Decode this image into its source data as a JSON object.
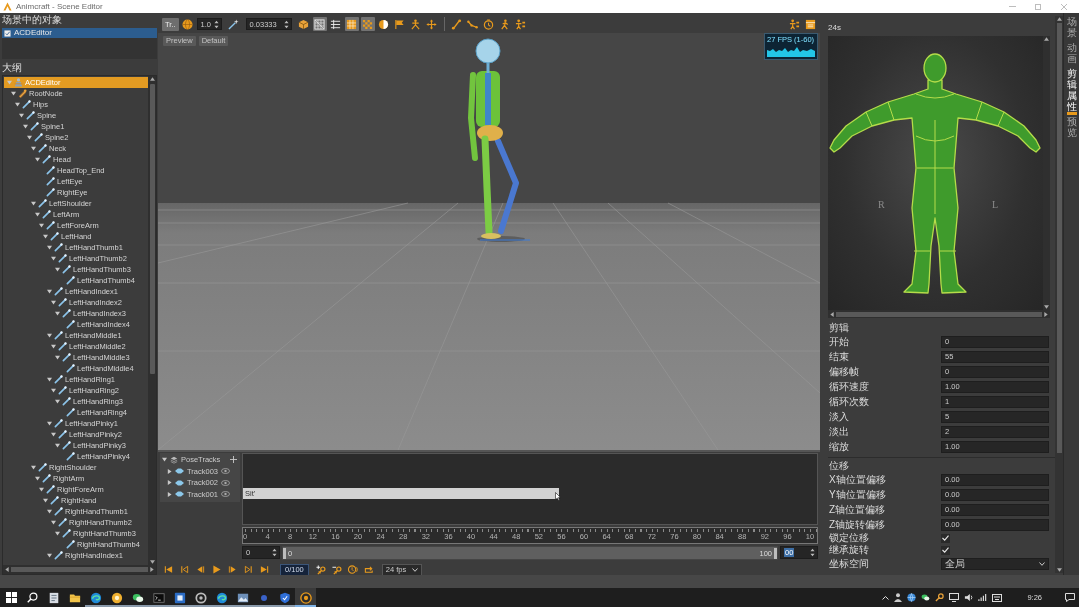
{
  "window": {
    "title": "Animcraft - Scene Editor"
  },
  "scene_panel": {
    "title": "场景中的对象",
    "items": [
      {
        "label": "ACDEditor",
        "selected": true
      }
    ]
  },
  "outline": {
    "title": "大纲",
    "tree": [
      {
        "label": "ACDEditor",
        "kind": "scene",
        "selected": true,
        "expanded": true,
        "children": [
          {
            "label": "RootNode",
            "kind": "root",
            "selected": false,
            "expanded": true,
            "children": [
              {
                "label": "Hips",
                "kind": "bone",
                "selected": false,
                "expanded": true,
                "children": [
                  {
                    "label": "Spine",
                    "kind": "bone",
                    "selected": false,
                    "expanded": true,
                    "children": [
                      {
                        "label": "Spine1",
                        "kind": "bone",
                        "selected": false,
                        "expanded": true,
                        "children": [
                          {
                            "label": "Spine2",
                            "kind": "bone",
                            "selected": false,
                            "expanded": true,
                            "children": [
                              {
                                "label": "Neck",
                                "kind": "bone",
                                "selected": false,
                                "expanded": true,
                                "children": [
                                  {
                                    "label": "Head",
                                    "kind": "bone",
                                    "selected": false,
                                    "expanded": true,
                                    "children": [
                                      {
                                        "label": "HeadTop_End",
                                        "kind": "bone",
                                        "selected": false
                                      },
                                      {
                                        "label": "LeftEye",
                                        "kind": "bone",
                                        "selected": false
                                      },
                                      {
                                        "label": "RightEye",
                                        "kind": "bone",
                                        "selected": false
                                      }
                                    ]
                                  }
                                ]
                              },
                              {
                                "label": "LeftShoulder",
                                "kind": "bone",
                                "selected": false,
                                "expanded": true,
                                "children": [
                                  {
                                    "label": "LeftArm",
                                    "kind": "bone",
                                    "selected": false,
                                    "expanded": true,
                                    "children": [
                                      {
                                        "label": "LeftForeArm",
                                        "kind": "bone",
                                        "selected": false,
                                        "expanded": true,
                                        "children": [
                                          {
                                            "label": "LeftHand",
                                            "kind": "bone",
                                            "selected": false,
                                            "expanded": true,
                                            "children": [
                                              {
                                                "label": "LeftHandThumb1",
                                                "kind": "bone",
                                                "selected": false,
                                                "expanded": true,
                                                "children": [
                                                  {
                                                    "label": "LeftHandThumb2",
                                                    "kind": "bone",
                                                    "selected": false,
                                                    "expanded": true,
                                                    "children": [
                                                      {
                                                        "label": "LeftHandThumb3",
                                                        "kind": "bone",
                                                        "selected": false,
                                                        "expanded": true,
                                                        "children": [
                                                          {
                                                            "label": "LeftHandThumb4",
                                                            "kind": "bone",
                                                            "selected": false
                                                          }
                                                        ]
                                                      }
                                                    ]
                                                  }
                                                ]
                                              },
                                              {
                                                "label": "LeftHandIndex1",
                                                "kind": "bone",
                                                "selected": false,
                                                "expanded": true,
                                                "children": [
                                                  {
                                                    "label": "LeftHandIndex2",
                                                    "kind": "bone",
                                                    "selected": false,
                                                    "expanded": true,
                                                    "children": [
                                                      {
                                                        "label": "LeftHandIndex3",
                                                        "kind": "bone",
                                                        "selected": false,
                                                        "expanded": true,
                                                        "children": [
                                                          {
                                                            "label": "LeftHandIndex4",
                                                            "kind": "bone",
                                                            "selected": false
                                                          }
                                                        ]
                                                      }
                                                    ]
                                                  }
                                                ]
                                              },
                                              {
                                                "label": "LeftHandMiddle1",
                                                "kind": "bone",
                                                "selected": false,
                                                "expanded": true,
                                                "children": [
                                                  {
                                                    "label": "LeftHandMiddle2",
                                                    "kind": "bone",
                                                    "selected": false,
                                                    "expanded": true,
                                                    "children": [
                                                      {
                                                        "label": "LeftHandMiddle3",
                                                        "kind": "bone",
                                                        "selected": false,
                                                        "expanded": true,
                                                        "children": [
                                                          {
                                                            "label": "LeftHandMiddle4",
                                                            "kind": "bone",
                                                            "selected": false
                                                          }
                                                        ]
                                                      }
                                                    ]
                                                  }
                                                ]
                                              },
                                              {
                                                "label": "LeftHandRing1",
                                                "kind": "bone",
                                                "selected": false,
                                                "expanded": true,
                                                "children": [
                                                  {
                                                    "label": "LeftHandRing2",
                                                    "kind": "bone",
                                                    "selected": false,
                                                    "expanded": true,
                                                    "children": [
                                                      {
                                                        "label": "LeftHandRing3",
                                                        "kind": "bone",
                                                        "selected": false,
                                                        "expanded": true,
                                                        "children": [
                                                          {
                                                            "label": "LeftHandRing4",
                                                            "kind": "bone",
                                                            "selected": false
                                                          }
                                                        ]
                                                      }
                                                    ]
                                                  }
                                                ]
                                              },
                                              {
                                                "label": "LeftHandPinky1",
                                                "kind": "bone",
                                                "selected": false,
                                                "expanded": true,
                                                "children": [
                                                  {
                                                    "label": "LeftHandPinky2",
                                                    "kind": "bone",
                                                    "selected": false,
                                                    "expanded": true,
                                                    "children": [
                                                      {
                                                        "label": "LeftHandPinky3",
                                                        "kind": "bone",
                                                        "selected": false,
                                                        "expanded": true,
                                                        "children": [
                                                          {
                                                            "label": "LeftHandPinky4",
                                                            "kind": "bone",
                                                            "selected": false
                                                          }
                                                        ]
                                                      }
                                                    ]
                                                  }
                                                ]
                                              }
                                            ]
                                          }
                                        ]
                                      }
                                    ]
                                  }
                                ]
                              },
                              {
                                "label": "RightShoulder",
                                "kind": "bone",
                                "selected": false,
                                "expanded": true,
                                "children": [
                                  {
                                    "label": "RightArm",
                                    "kind": "bone",
                                    "selected": false,
                                    "expanded": true,
                                    "children": [
                                      {
                                        "label": "RightForeArm",
                                        "kind": "bone",
                                        "selected": false,
                                        "expanded": true,
                                        "children": [
                                          {
                                            "label": "RightHand",
                                            "kind": "bone",
                                            "selected": false,
                                            "expanded": true,
                                            "children": [
                                              {
                                                "label": "RightHandThumb1",
                                                "kind": "bone",
                                                "selected": false,
                                                "expanded": true,
                                                "children": [
                                                  {
                                                    "label": "RightHandThumb2",
                                                    "kind": "bone",
                                                    "selected": false,
                                                    "expanded": true,
                                                    "children": [
                                                      {
                                                        "label": "RightHandThumb3",
                                                        "kind": "bone",
                                                        "selected": false,
                                                        "expanded": true,
                                                        "children": [
                                                          {
                                                            "label": "RightHandThumb4",
                                                            "kind": "bone",
                                                            "selected": false
                                                          }
                                                        ]
                                                      }
                                                    ]
                                                  }
                                                ]
                                              },
                                              {
                                                "label": "RightHandIndex1",
                                                "kind": "bone",
                                                "selected": false,
                                                "expanded": true
                                              }
                                            ]
                                          }
                                        ]
                                      }
                                    ]
                                  }
                                ]
                              }
                            ]
                          }
                        ]
                      }
                    ]
                  }
                ]
              }
            ]
          }
        ]
      }
    ]
  },
  "toolbar": {
    "mode_label": "Tr..",
    "scale": "1.0",
    "step": "0.03333",
    "tools": [
      {
        "kind": "cube",
        "on": false
      },
      {
        "kind": "mesh",
        "on": true
      },
      {
        "kind": "list",
        "on": false
      },
      {
        "kind": "table",
        "on": true
      },
      {
        "kind": "checker",
        "on": true
      },
      {
        "kind": "half",
        "on": false
      },
      {
        "kind": "flag",
        "on": false
      },
      {
        "kind": "joint",
        "on": false
      },
      {
        "kind": "move",
        "on": false
      }
    ],
    "bone_tools": [
      {
        "kind": "bone",
        "on": false
      },
      {
        "kind": "chain",
        "on": false
      },
      {
        "kind": "timer",
        "on": false
      },
      {
        "kind": "walk",
        "on": false
      },
      {
        "kind": "figure",
        "on": false
      }
    ]
  },
  "viewport": {
    "buttons": [
      "Preview",
      "Default"
    ],
    "fps": "27 FPS (1-60)"
  },
  "timeline": {
    "group": {
      "label": "PoseTracks",
      "expanded": true
    },
    "tracks": [
      {
        "label": "Track003",
        "expanded": false,
        "visible": true
      },
      {
        "label": "Track002",
        "expanded": false,
        "visible": true
      },
      {
        "label": "Track001",
        "expanded": false,
        "visible": true,
        "clip": {
          "label": "Sit'",
          "level": 0.55
        }
      }
    ],
    "ruler": [
      "0",
      "4",
      "8",
      "12",
      "16",
      "20",
      "24",
      "28",
      "32",
      "36",
      "40",
      "44",
      "48",
      "52",
      "56",
      "60",
      "64",
      "68",
      "72",
      "76",
      "80",
      "84",
      "88",
      "92",
      "96",
      "10"
    ],
    "range": {
      "start": "0",
      "slider_start": "0",
      "slider_end": "100",
      "level": 1,
      "end": "00"
    },
    "frame": "0/100",
    "fps": "24 fps"
  },
  "clip_panel": {
    "title": "24s",
    "figure_labels": [
      "R",
      "L"
    ],
    "sections": [
      {
        "title": "剪辑",
        "rows": [
          {
            "kind": "text",
            "label": "开始",
            "value": "0"
          },
          {
            "kind": "text",
            "label": "结束",
            "value": "55"
          },
          {
            "kind": "text",
            "label": "偏移帧",
            "value": "0"
          },
          {
            "kind": "text",
            "label": "循环速度",
            "value": "1.00"
          },
          {
            "kind": "text",
            "label": "循环次数",
            "value": "1"
          },
          {
            "kind": "text",
            "label": "淡入",
            "value": "5"
          },
          {
            "kind": "text",
            "label": "淡出",
            "value": "2"
          },
          {
            "kind": "text",
            "label": "缩放",
            "value": "1.00"
          }
        ]
      },
      {
        "title": "位移",
        "rows": [
          {
            "kind": "text",
            "label": "X轴位置偏移",
            "value": "0.00"
          },
          {
            "kind": "text",
            "label": "Y轴位置偏移",
            "value": "0.00"
          },
          {
            "kind": "text",
            "label": "Z轴位置偏移",
            "value": "0.00"
          },
          {
            "kind": "text",
            "label": "Z轴旋转偏移",
            "value": "0.00"
          },
          {
            "kind": "check",
            "label": "锁定位移",
            "checked": true
          },
          {
            "kind": "check",
            "label": "继承旋转",
            "checked": true
          },
          {
            "kind": "select",
            "label": "坐标空间",
            "value": "全局"
          }
        ]
      }
    ]
  },
  "side_tabs": [
    {
      "label": "场景",
      "selected": false
    },
    {
      "label": "动画",
      "selected": false
    },
    {
      "label": "剪辑属性",
      "selected": true
    },
    {
      "label": "预览",
      "selected": false
    }
  ],
  "taskbar": {
    "apps": [
      {
        "kind": "document",
        "running": false,
        "selected": false
      },
      {
        "kind": "folder",
        "running": false,
        "selected": false
      },
      {
        "kind": "swirl",
        "running": true,
        "selected": false
      },
      {
        "kind": "ball",
        "running": true,
        "selected": false
      },
      {
        "kind": "chat",
        "running": true,
        "selected": false
      },
      {
        "kind": "terminal",
        "running": true,
        "selected": false
      },
      {
        "kind": "tile",
        "running": true,
        "selected": false
      },
      {
        "kind": "ring",
        "running": true,
        "selected": false
      },
      {
        "kind": "swirl",
        "running": true,
        "selected": false
      },
      {
        "kind": "picture",
        "running": true,
        "selected": false
      },
      {
        "kind": "dot",
        "running": true,
        "selected": false
      },
      {
        "kind": "shield",
        "running": true,
        "selected": false
      },
      {
        "kind": "disc",
        "running": true,
        "selected": true
      }
    ],
    "time": "9:26"
  }
}
